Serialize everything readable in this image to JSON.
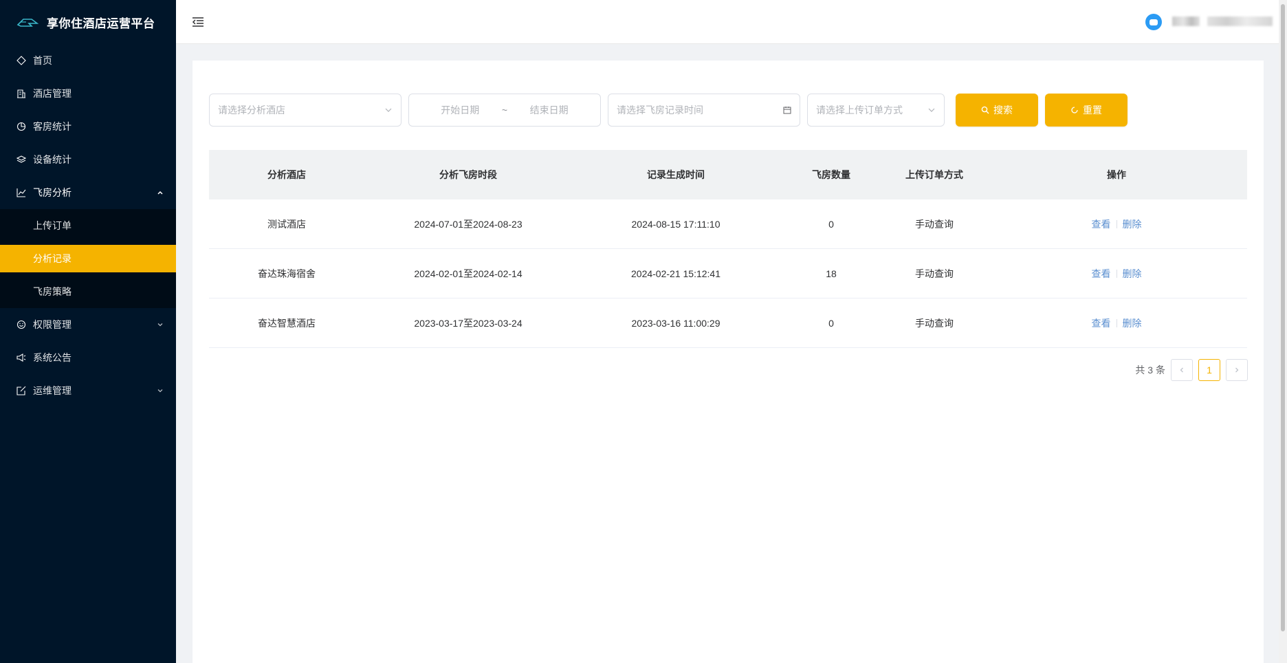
{
  "app": {
    "title": "享你住酒店运营平台"
  },
  "sidebar": {
    "items": [
      {
        "label": "首页",
        "icon": "home-icon"
      },
      {
        "label": "酒店管理",
        "icon": "building-icon"
      },
      {
        "label": "客房统计",
        "icon": "pie-chart-icon"
      },
      {
        "label": "设备统计",
        "icon": "layers-icon"
      },
      {
        "label": "飞房分析",
        "icon": "line-chart-icon",
        "expanded": true,
        "children": [
          {
            "label": "上传订单"
          },
          {
            "label": "分析记录",
            "active": true
          },
          {
            "label": "飞房策略"
          }
        ]
      },
      {
        "label": "权限管理",
        "icon": "smile-icon"
      },
      {
        "label": "系统公告",
        "icon": "announce-icon"
      },
      {
        "label": "运维管理",
        "icon": "edit-icon"
      }
    ]
  },
  "filters": {
    "hotel_placeholder": "请选择分析酒店",
    "start_placeholder": "开始日期",
    "range_sep": "~",
    "end_placeholder": "结束日期",
    "record_time_placeholder": "请选择飞房记录时间",
    "method_placeholder": "请选择上传订单方式",
    "search_label": "搜索",
    "reset_label": "重置"
  },
  "table": {
    "headers": [
      "分析酒店",
      "分析飞房时段",
      "记录生成时间",
      "飞房数量",
      "上传订单方式",
      "操作"
    ],
    "rows": [
      {
        "hotel": "测试酒店",
        "period": "2024-07-01至2024-08-23",
        "created": "2024-08-15 17:11:10",
        "count": "0",
        "method": "手动查询"
      },
      {
        "hotel": "奋达珠海宿舍",
        "period": "2024-02-01至2024-02-14",
        "created": "2024-02-21 15:12:41",
        "count": "18",
        "method": "手动查询"
      },
      {
        "hotel": "奋达智慧酒店",
        "period": "2023-03-17至2023-03-24",
        "created": "2023-03-16 11:00:29",
        "count": "0",
        "method": "手动查询"
      }
    ],
    "action_view": "查看",
    "action_delete": "删除"
  },
  "pagination": {
    "total_text": "共 3 条",
    "current_page": "1"
  },
  "colors": {
    "sidebar_bg": "#001529",
    "accent": "#f5b300",
    "link": "#5b8fd0"
  }
}
